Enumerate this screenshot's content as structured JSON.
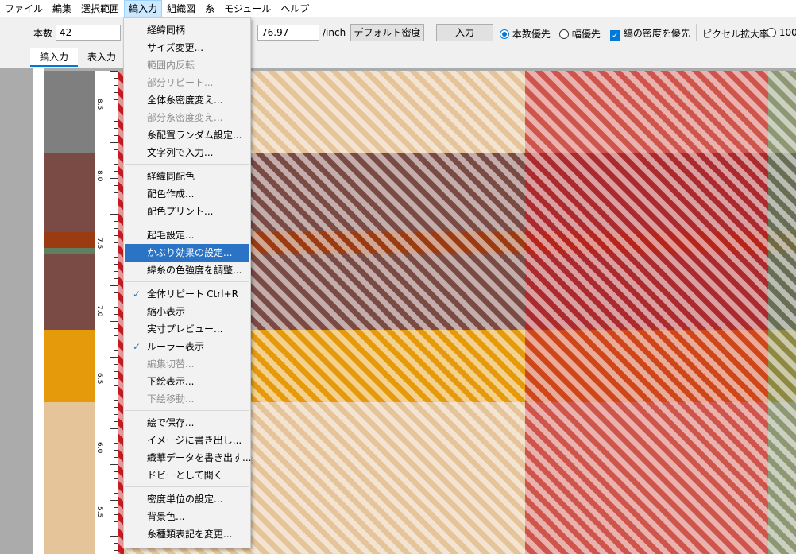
{
  "menubar": {
    "items": [
      "ファイル",
      "編集",
      "選択範囲",
      "縞入力",
      "組織図",
      "糸",
      "モジュール",
      "ヘルプ"
    ],
    "active_index": 3
  },
  "toolbar": {
    "count_label": "本数",
    "count_value": "42",
    "density_value": "76.97",
    "density_unit": "/inch",
    "default_density_button": "デフォルト密度",
    "input_button": "入力",
    "radio_count_priority": "本数優先",
    "radio_width_priority": "幅優先",
    "checkbox_keep_density": "縞の密度を優先",
    "pixel_zoom_label": "ピクセル拡大率",
    "pixel_zoom_option": "100"
  },
  "tabs": [
    "縞入力",
    "表入力"
  ],
  "ruler": {
    "labels": [
      "8.5",
      "8.0",
      "7.5",
      "7.0",
      "6.5",
      "6.0",
      "5.5"
    ]
  },
  "menu": {
    "items": [
      {
        "label": "経緯同柄",
        "disabled": false
      },
      {
        "label": "サイズ変更...",
        "disabled": false
      },
      {
        "label": "範囲内反転",
        "disabled": true
      },
      {
        "label": "部分リピート...",
        "disabled": true
      },
      {
        "label": "全体糸密度変え...",
        "disabled": false
      },
      {
        "label": "部分糸密度変え...",
        "disabled": true
      },
      {
        "label": "糸配置ランダム設定...",
        "disabled": false
      },
      {
        "label": "文字列で入力...",
        "disabled": false
      },
      {
        "sep": true
      },
      {
        "label": "経緯同配色",
        "disabled": false
      },
      {
        "label": "配色作成...",
        "disabled": false
      },
      {
        "label": "配色プリント...",
        "disabled": false
      },
      {
        "sep": true
      },
      {
        "label": "起毛設定...",
        "disabled": false
      },
      {
        "label": "かぶり効果の設定...",
        "disabled": false,
        "highlight": true
      },
      {
        "label": "緯糸の色強度を調整...",
        "disabled": false
      },
      {
        "sep": true
      },
      {
        "label": "全体リピート",
        "disabled": false,
        "checked": true,
        "shortcut": "Ctrl+R"
      },
      {
        "label": "縮小表示",
        "disabled": false
      },
      {
        "label": "実寸プレビュー...",
        "disabled": false
      },
      {
        "label": "ルーラー表示",
        "disabled": false,
        "checked": true
      },
      {
        "label": "編集切替...",
        "disabled": true
      },
      {
        "label": "下絵表示...",
        "disabled": false
      },
      {
        "label": "下絵移動...",
        "disabled": true
      },
      {
        "sep": true
      },
      {
        "label": "絵で保存...",
        "disabled": false
      },
      {
        "label": "イメージに書き出し...",
        "disabled": false
      },
      {
        "label": "織華データを書き出す...",
        "disabled": false
      },
      {
        "label": "ドビーとして開く",
        "disabled": false
      },
      {
        "sep": true
      },
      {
        "label": "密度単位の設定...",
        "disabled": false
      },
      {
        "label": "背景色...",
        "disabled": false
      },
      {
        "label": "糸種類表記を変更...",
        "disabled": false
      }
    ]
  },
  "colors": {
    "accent": "#0078d7",
    "menu_highlight": "#2a73c5",
    "gray": "#7f7f7f",
    "brown": "#7a4b45",
    "rust": "#9a3b12",
    "orange": "#e59a0c",
    "beige": "#e5c49a",
    "red": "#c41a22",
    "green": "#5f8060",
    "cream": "#f3e6d0"
  }
}
